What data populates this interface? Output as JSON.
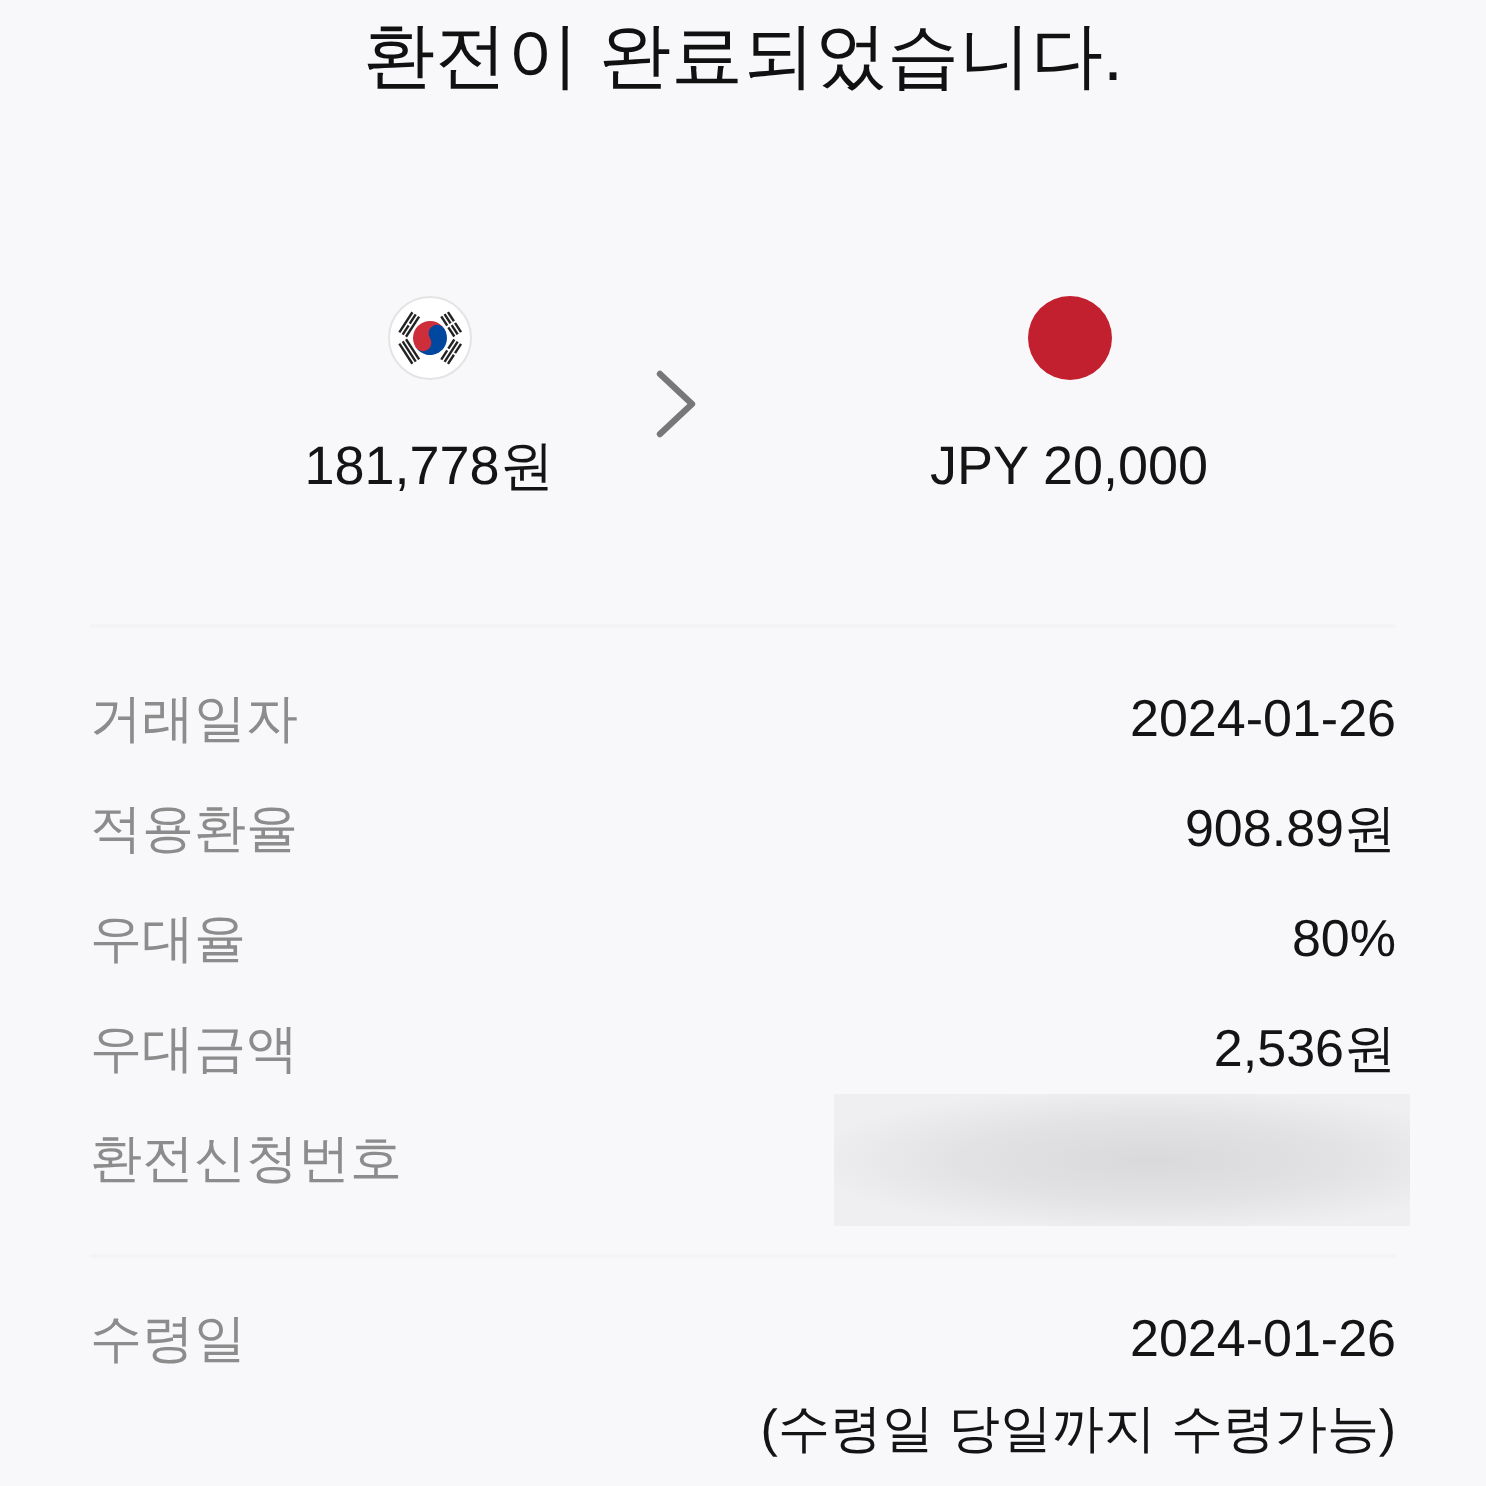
{
  "title": "환전이 완료되었습니다.",
  "exchange": [
    {
      "kind": "kr",
      "amount": "181,778원"
    },
    {
      "kind": "jp",
      "amount": "JPY 20,000"
    }
  ],
  "details": [
    {
      "kind": "text",
      "label": "거래일자",
      "value": "2024-01-26"
    },
    {
      "kind": "text",
      "label": "적용환율",
      "value": "908.89원"
    },
    {
      "kind": "text",
      "label": "우대율",
      "value": "80%"
    },
    {
      "kind": "text",
      "label": "우대금액",
      "value": "2,536원"
    },
    {
      "kind": "redacted",
      "label": "환전신청번호"
    }
  ],
  "receipt": [
    {
      "kind": "text",
      "label": "수령일",
      "value": "2024-01-26",
      "note": "(수령일 당일까지 수령가능)"
    }
  ]
}
